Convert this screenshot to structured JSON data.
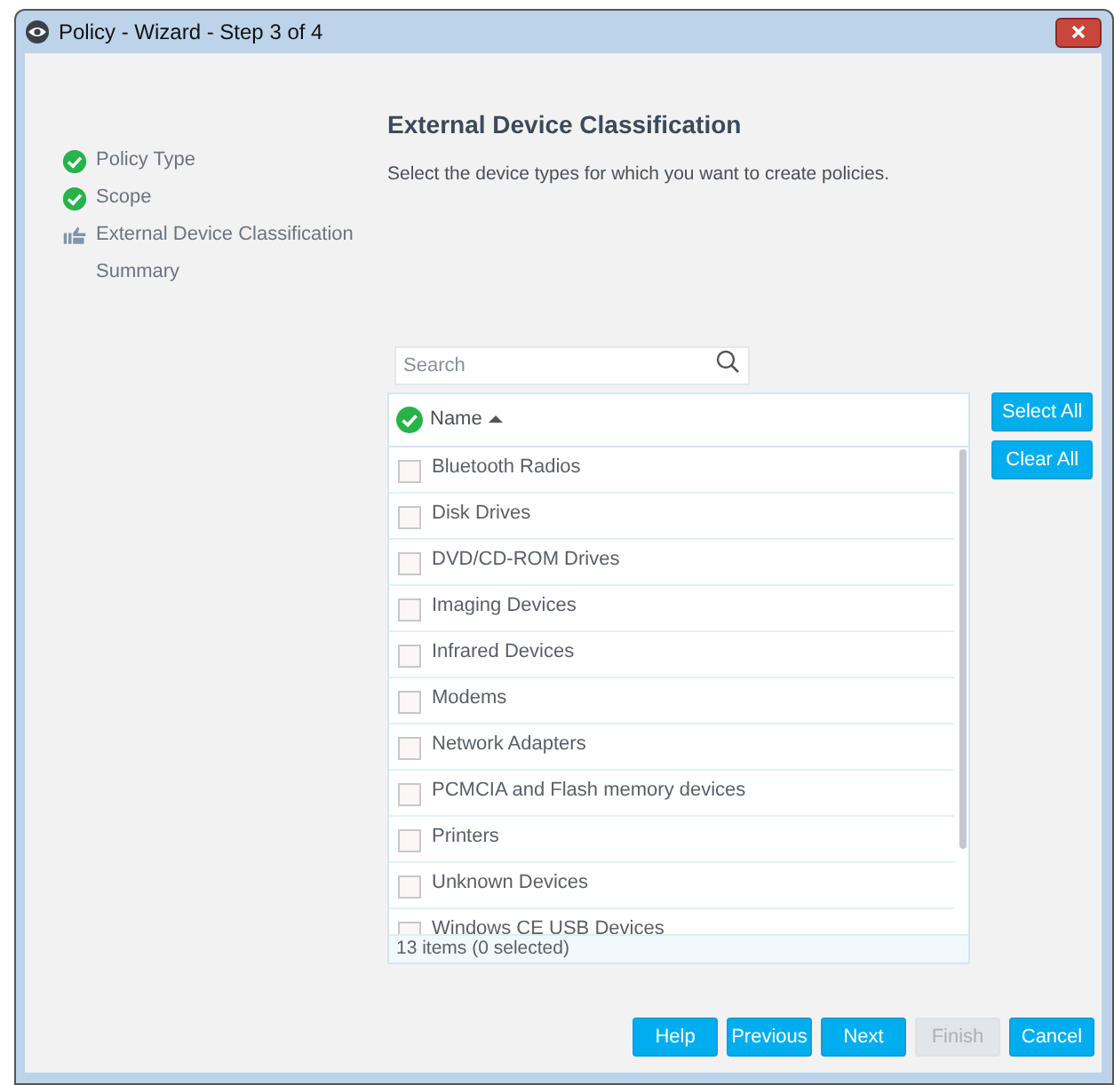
{
  "window": {
    "title": "Policy - Wizard - Step 3 of 4"
  },
  "steps": [
    {
      "label": "Policy Type",
      "done": true,
      "current": false
    },
    {
      "label": "Scope",
      "done": true,
      "current": false
    },
    {
      "label": "External Device Classification",
      "done": false,
      "current": true
    },
    {
      "label": "Summary",
      "done": false,
      "current": false
    }
  ],
  "heading": "External Device Classification",
  "description": "Select the device types for which you want to create policies.",
  "search": {
    "placeholder": "Search"
  },
  "table": {
    "columns": [
      {
        "label": "Name",
        "sorted_ascending": true
      }
    ],
    "rows": [
      {
        "name": "Bluetooth Radios",
        "checked": false
      },
      {
        "name": "Disk Drives",
        "checked": false
      },
      {
        "name": "DVD/CD-ROM Drives",
        "checked": false
      },
      {
        "name": "Imaging Devices",
        "checked": false
      },
      {
        "name": "Infrared Devices",
        "checked": false
      },
      {
        "name": "Modems",
        "checked": false
      },
      {
        "name": "Network Adapters",
        "checked": false
      },
      {
        "name": "PCMCIA and Flash memory devices",
        "checked": false
      },
      {
        "name": "Printers",
        "checked": false
      },
      {
        "name": "Unknown Devices",
        "checked": false
      },
      {
        "name": "Windows CE USB Devices",
        "checked": false
      }
    ],
    "footer": "13 items (0 selected)"
  },
  "side_buttons": [
    {
      "label": "Select All",
      "disabled": false
    },
    {
      "label": "Clear All",
      "disabled": false
    }
  ],
  "buttons": [
    {
      "label": "Help",
      "disabled": false
    },
    {
      "label": "Previous",
      "disabled": false
    },
    {
      "label": "Next",
      "disabled": false
    },
    {
      "label": "Finish",
      "disabled": true
    },
    {
      "label": "Cancel",
      "disabled": false
    }
  ]
}
